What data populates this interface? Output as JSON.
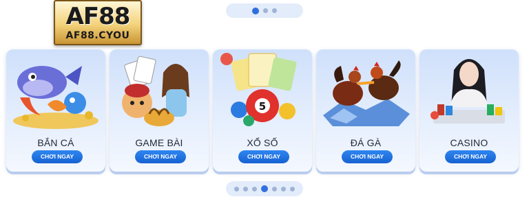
{
  "logo": {
    "main": "AF88",
    "sub": "AF88.CYOU"
  },
  "carousel_top": {
    "active_index": 0,
    "dot_count": 3
  },
  "carousel_bottom": {
    "active_index": 3,
    "dot_count": 7
  },
  "cards": [
    {
      "title": "BẮN CÁ",
      "button": "CHƠI NGAY",
      "icon": "fish-shooting-icon"
    },
    {
      "title": "GAME BÀI",
      "button": "CHƠI NGAY",
      "icon": "card-game-icon"
    },
    {
      "title": "XỔ SỐ",
      "button": "CHƠI NGAY",
      "icon": "lottery-ball-icon"
    },
    {
      "title": "ĐÁ GÀ",
      "button": "CHƠI NGAY",
      "icon": "rooster-icon"
    },
    {
      "title": "CASINO",
      "button": "CHƠI NGAY",
      "icon": "casino-dealer-icon"
    }
  ],
  "colors": {
    "accent": "#1662d2",
    "card_bg": "#cfe0fb",
    "dot_active": "#2f6fdf",
    "dot_inactive": "#9fb3d6"
  }
}
